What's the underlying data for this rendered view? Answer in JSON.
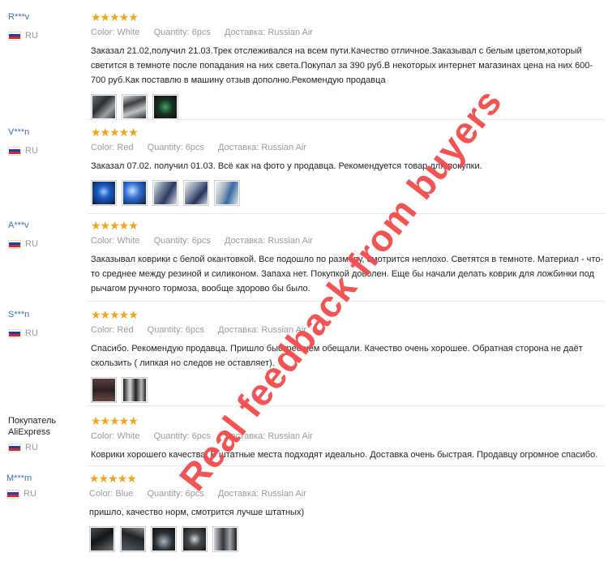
{
  "meta_labels": {
    "color": "Color:",
    "quantity": "Quantity:",
    "shipping": "Доставка:"
  },
  "reviews": [
    {
      "user": "R***v",
      "country": "RU",
      "stars": "★★★★★",
      "color": "Color: White",
      "quantity": "Quantity: 6pcs",
      "shipping": "Доставка: Russian Air",
      "text": "Заказал 21.02,получил 21.03.Трек отслеживался на всем пути.Качество отличное.Заказывал с белым цветом,который светится в темноте после попадания на них света.Покупал за 390 руб.В некоторых интернет магазинах цена на них 600-700 руб.Как поставлю в машину отзыв дополню.Рекомендую продавца",
      "photos": [
        "photo-1",
        "photo-2",
        "photo-3"
      ]
    },
    {
      "user": "V***n",
      "country": "RU",
      "stars": "★★★★★",
      "color": "Color: Red",
      "quantity": "Quantity: 6pcs",
      "shipping": "Доставка: Russian Air",
      "text": "Заказал 07.02. получил 01.03. Всё как на фото у продавца. Рекомендуется товар для покупки.",
      "photos": [
        "photo-1",
        "photo-2",
        "photo-3",
        "photo-4",
        "photo-5"
      ]
    },
    {
      "user": "A***v",
      "country": "RU",
      "stars": "★★★★★",
      "color": "Color: White",
      "quantity": "Quantity: 6pcs",
      "shipping": "Доставка: Russian Air",
      "text": "Заказывал коврики с белой окантовкой. Все подошло по размеру, смотрится неплохо. Светятся в темноте. Материал - что-то среднее между резиной и силиконом. Запаха нет. Покупкой доволен. Еще бы начали делать коврик для ложбинки под рычагом ручного тормоза, вообще здорово бы было.",
      "photos": []
    },
    {
      "user": "S***n",
      "country": "RU",
      "stars": "★★★★★",
      "color": "Color: Red",
      "quantity": "Quantity: 6pcs",
      "shipping": "Доставка: Russian Air",
      "text": "Спасибо. Рекомендую продавца. Пришло быстрее чем обещали. Качество очень хорошее. Обратная сторона не даёт скользить ( липкая но следов не оставляет).",
      "photos": [
        "photo-1",
        "photo-2"
      ]
    },
    {
      "user": "Покупатель AliExpress",
      "country": "RU",
      "stars": "★★★★★",
      "color": "Color: White",
      "quantity": "Quantity: 6pcs",
      "shipping": "Доставка: Russian Air",
      "text": "Коврики хорошего качества. В штатные места подходят идеально. Доставка очень быстрая. Продавцу огромное спасибо.",
      "photos": []
    },
    {
      "user": "M***m",
      "country": "RU",
      "stars": "★★★★★",
      "color": "Color: Blue",
      "quantity": "Quantity: 6pcs",
      "shipping": "Доставка: Russian Air",
      "text": "пришло, качество норм, смотрится лучше штатных)",
      "photos": [
        "photo-1",
        "photo-2",
        "photo-3",
        "photo-4",
        "photo-5"
      ]
    }
  ],
  "watermark": "Real  feedback  from  buyers",
  "colors": {
    "star": "#f2a41a",
    "username": "#3a6fb0",
    "watermark": "#f44a4a"
  }
}
